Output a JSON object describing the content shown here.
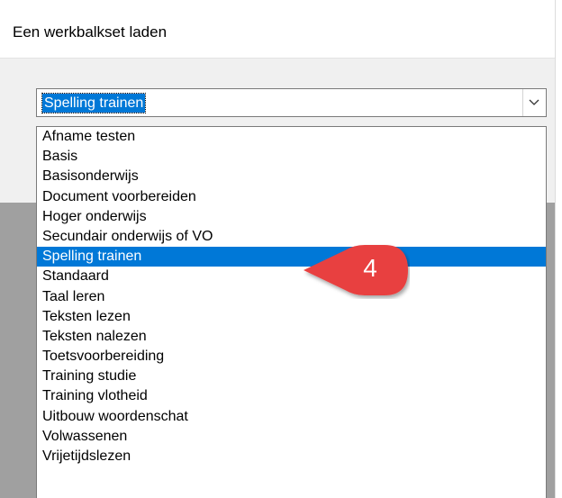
{
  "dialog": {
    "title": "Een werkbalkset laden"
  },
  "combo": {
    "selected_value": "Spelling trainen",
    "dropdown_icon": "chevron-down-icon"
  },
  "list": {
    "items": [
      "Afname testen",
      "Basis",
      "Basisonderwijs",
      "Document voorbereiden",
      "Hoger onderwijs",
      "Secundair onderwijs of VO",
      "Spelling trainen",
      "Standaard",
      "Taal leren",
      "Teksten lezen",
      "Teksten nalezen",
      "Toetsvoorbereiding",
      "Training studie",
      "Training vlotheid",
      "Uitbouw woordenschat",
      "Volwassenen",
      "Vrijetijdslezen"
    ],
    "selected_index": 6
  },
  "callout": {
    "number": "4",
    "color": "#e8413f"
  },
  "colors": {
    "selection": "#0078d7",
    "panel": "#f0f0f0",
    "backdrop": "#a0a0a0"
  }
}
